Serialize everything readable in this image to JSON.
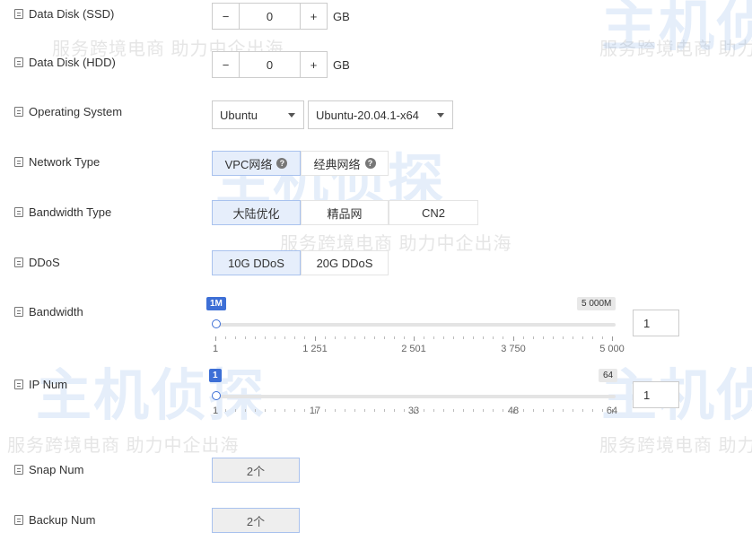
{
  "data_disk_ssd": {
    "label": "Data Disk (SSD)",
    "value": "0",
    "unit": "GB",
    "minus": "−",
    "plus": "+"
  },
  "data_disk_hdd": {
    "label": "Data Disk (HDD)",
    "value": "0",
    "unit": "GB",
    "minus": "−",
    "plus": "+"
  },
  "os": {
    "label": "Operating System",
    "family": "Ubuntu",
    "version": "Ubuntu-20.04.1-x64"
  },
  "network_type": {
    "label": "Network Type",
    "options": [
      "VPC网络",
      "经典网络"
    ],
    "selected": "VPC网络"
  },
  "bandwidth_type": {
    "label": "Bandwidth Type",
    "options": [
      "大陆优化",
      "精品网",
      "CN2"
    ],
    "selected": "大陆优化"
  },
  "ddos": {
    "label": "DDoS",
    "options": [
      "10G DDoS",
      "20G DDoS"
    ],
    "selected": "10G DDoS"
  },
  "bandwidth": {
    "label": "Bandwidth",
    "min_badge": "1M",
    "max_badge": "5 000M",
    "ticks": [
      "1",
      "1 251",
      "2 501",
      "3 750",
      "5 000"
    ],
    "value": "1",
    "slider_fraction": 0
  },
  "ip_num": {
    "label": "IP Num",
    "min_badge": "1",
    "max_badge": "64",
    "ticks": [
      "1",
      "17",
      "33",
      "48",
      "64"
    ],
    "value": "1",
    "slider_fraction": 0
  },
  "snap_num": {
    "label": "Snap Num",
    "value": "2个"
  },
  "backup_num": {
    "label": "Backup Num",
    "value": "2个"
  },
  "watermark": {
    "brand": "主机侦探",
    "slogan": "服务跨境电商 助力中企出海"
  },
  "colors": {
    "accent": "#3d6fd6",
    "selected_bg": "#e6eefb",
    "selected_border": "#a9c2ee"
  },
  "icons": {
    "row_icon": "document-icon",
    "help_icon": "question-circle-icon",
    "dropdown_icon": "caret-down-icon"
  }
}
